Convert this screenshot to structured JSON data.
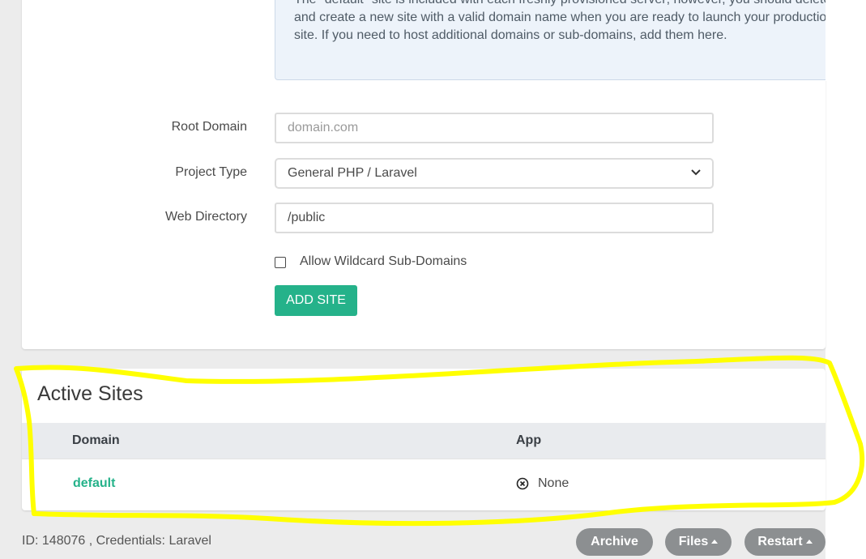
{
  "notice": {
    "text": "The \"default\" site is included with each freshly provisioned server; however, you should delete it and create a new site with a valid domain name when you are ready to launch your production site. If you need to host additional domains or sub-domains, add them here."
  },
  "form": {
    "root_domain_label": "Root Domain",
    "root_domain_placeholder": "domain.com",
    "project_type_label": "Project Type",
    "project_type_value": "General PHP / Laravel",
    "web_directory_label": "Web Directory",
    "web_directory_value": "/public",
    "wildcard_label": "Allow Wildcard Sub-Domains",
    "add_site_label": "ADD SITE"
  },
  "active_sites": {
    "title": "Active Sites",
    "columns": [
      "Domain",
      "App"
    ],
    "rows": [
      {
        "domain": "default",
        "app": "None"
      }
    ]
  },
  "footer": {
    "id_text": "ID: 148076 , Credentials: Laravel",
    "archive_label": "Archive",
    "files_label": "Files",
    "restart_label": "Restart"
  },
  "colors": {
    "accent": "#25b28a",
    "highlight": "#ffff00"
  }
}
